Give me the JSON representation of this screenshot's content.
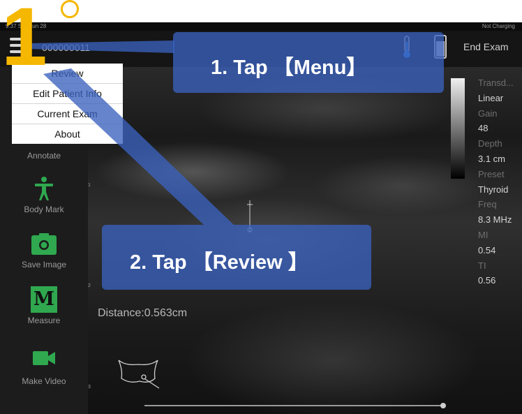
{
  "status": {
    "time": "9:37  Sun Jun 28",
    "battery": "Not Charging"
  },
  "header": {
    "patient_id": "000000011",
    "end_exam_label": "End Exam"
  },
  "menu": {
    "items": [
      {
        "label": "Review"
      },
      {
        "label": "Edit Patient Info"
      },
      {
        "label": "Current Exam"
      },
      {
        "label": "About"
      }
    ]
  },
  "sidebar": {
    "items": [
      {
        "label": "Annotate",
        "icon": "annotate-icon"
      },
      {
        "label": "Body Mark",
        "icon": "body-mark-icon"
      },
      {
        "label": "Save Image",
        "icon": "camera-icon"
      },
      {
        "label": "Measure",
        "icon": "measure-icon",
        "glyph": "M"
      },
      {
        "label": "Make Video",
        "icon": "video-camera-icon"
      }
    ]
  },
  "params": {
    "items": [
      {
        "key": "Transd...",
        "value": "Linear"
      },
      {
        "key": "Gain",
        "value": "48"
      },
      {
        "key": "Depth",
        "value": "3.1 cm"
      },
      {
        "key": "Preset",
        "value": "Thyroid"
      },
      {
        "key": "Freq",
        "value": "8.3 MHz"
      },
      {
        "key": "MI",
        "value": "0.54"
      },
      {
        "key": "TI",
        "value": "0.56"
      }
    ]
  },
  "image": {
    "distance": "Distance:0.563cm",
    "depth_ticks": [
      "1",
      "2",
      "3"
    ]
  },
  "tutorial": {
    "step_number": "1",
    "callout1": "1. Tap 【Menu】",
    "callout2": "2. Tap 【Review 】"
  },
  "colors": {
    "accent": "#f5b700",
    "callout": "#3a62be",
    "icon_green": "#2fa84f"
  }
}
